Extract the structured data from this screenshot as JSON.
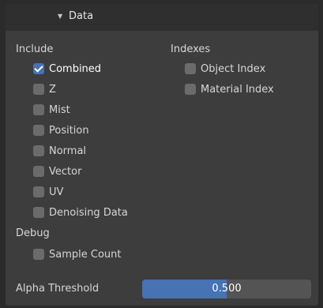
{
  "panel": {
    "title": "Data",
    "collapse_icon": "triangle-down-icon"
  },
  "include": {
    "heading": "Include",
    "items": [
      {
        "label": "Combined",
        "checked": true
      },
      {
        "label": "Z",
        "checked": false
      },
      {
        "label": "Mist",
        "checked": false
      },
      {
        "label": "Position",
        "checked": false
      },
      {
        "label": "Normal",
        "checked": false
      },
      {
        "label": "Vector",
        "checked": false
      },
      {
        "label": "UV",
        "checked": false
      },
      {
        "label": "Denoising Data",
        "checked": false
      }
    ]
  },
  "indexes": {
    "heading": "Indexes",
    "items": [
      {
        "label": "Object Index",
        "checked": false
      },
      {
        "label": "Material Index",
        "checked": false
      }
    ]
  },
  "debug": {
    "heading": "Debug",
    "items": [
      {
        "label": "Sample Count",
        "checked": false
      }
    ]
  },
  "alpha_threshold": {
    "label": "Alpha Threshold",
    "value": 0.5,
    "display": "0.500"
  },
  "colors": {
    "accent": "#4772b3",
    "panel": "#3d3d3d",
    "header": "#2f2f2f",
    "checkbox_off": "#6b6b6b",
    "slider_track": "#545454"
  }
}
